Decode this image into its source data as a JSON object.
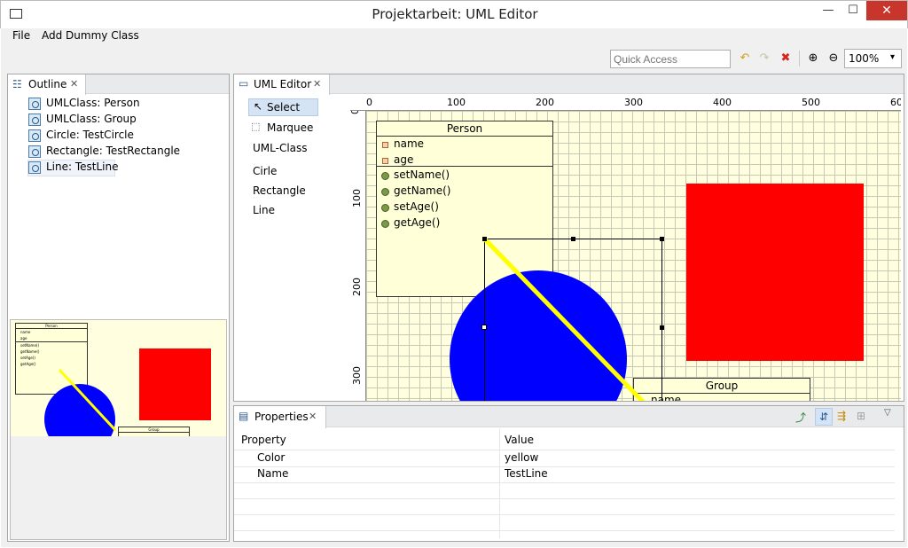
{
  "window": {
    "title": "Projektarbeit: UML Editor",
    "minimize": "—",
    "maximize": "☐",
    "close": "✕"
  },
  "menu": {
    "file": "File",
    "add_dummy": "Add Dummy Class"
  },
  "toolbar": {
    "quick_access_placeholder": "Quick Access",
    "zoom_value": "100%",
    "zoom_arrow": "▾"
  },
  "outline": {
    "tab_label": "Outline",
    "tab_close": "✕",
    "items": [
      {
        "label": "UMLClass: Person"
      },
      {
        "label": "UMLClass: Group"
      },
      {
        "label": "Circle: TestCircle"
      },
      {
        "label": "Rectangle: TestRectangle"
      },
      {
        "label": "Line: TestLine"
      }
    ]
  },
  "editor": {
    "tab_label": "UML Editor",
    "tab_close": "✕",
    "palette": [
      "Select",
      "Marquee",
      "UML-Class",
      "Cirle",
      "Rectangle",
      "Line"
    ],
    "ruler_h": [
      "0",
      "100",
      "200",
      "300",
      "400",
      "500",
      "60"
    ],
    "ruler_v": [
      "0",
      "100",
      "200",
      "300"
    ],
    "person": {
      "title": "Person",
      "attributes": [
        "name",
        "age"
      ],
      "methods": [
        "setName()",
        "getName()",
        "setAge()",
        "getAge()"
      ]
    },
    "group": {
      "title": "Group",
      "first_attr": "name"
    }
  },
  "minimap": {
    "person_title": "Person",
    "group_title": "Group",
    "rows": [
      "name",
      "age",
      "setName()",
      "getName()",
      "setAge()",
      "getAge()"
    ]
  },
  "properties": {
    "tab_label": "Properties",
    "tab_close": "✕",
    "col_property": "Property",
    "col_value": "Value",
    "rows": [
      {
        "property": "Color",
        "value": "yellow"
      },
      {
        "property": "Name",
        "value": "TestLine"
      }
    ]
  },
  "colors": {
    "canvas_bg": "#ffffe0",
    "line": "#ffff00",
    "circle": "#0000ff",
    "rectangle": "#ff0000",
    "uml_fill": "#ffffd8"
  },
  "icons": [
    "outline-icon",
    "editor-icon",
    "properties-icon",
    "undo-icon",
    "redo-icon",
    "delete-icon",
    "zoom-in-icon",
    "zoom-out-icon",
    "select-arrow-icon",
    "marquee-icon"
  ]
}
